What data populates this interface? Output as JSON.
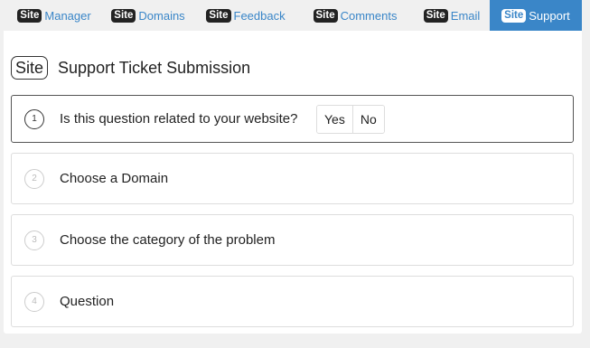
{
  "tabs": [
    {
      "badge": "Site",
      "label": "Manager",
      "active": false
    },
    {
      "badge": "Site",
      "label": "Domains",
      "active": false
    },
    {
      "badge": "Site",
      "label": "Feedback",
      "active": false
    },
    {
      "badge": "Site",
      "label": "Comments",
      "active": false
    },
    {
      "badge": "Site",
      "label": "Email",
      "active": false
    },
    {
      "badge": "Site",
      "label": "Support",
      "active": true
    }
  ],
  "header": {
    "logo_text": "Site",
    "title": "Support Ticket Submission"
  },
  "steps": [
    {
      "number": "1",
      "label": "Is this question related to your website?",
      "active": true
    },
    {
      "number": "2",
      "label": "Choose a Domain",
      "active": false
    },
    {
      "number": "3",
      "label": "Choose the category of the problem",
      "active": false
    },
    {
      "number": "4",
      "label": "Question",
      "active": false
    }
  ],
  "answer": {
    "yes_label": "Yes",
    "no_label": "No"
  },
  "colors": {
    "accent": "#3a86c8",
    "badge": "#222222",
    "background": "#f0f0f0"
  }
}
